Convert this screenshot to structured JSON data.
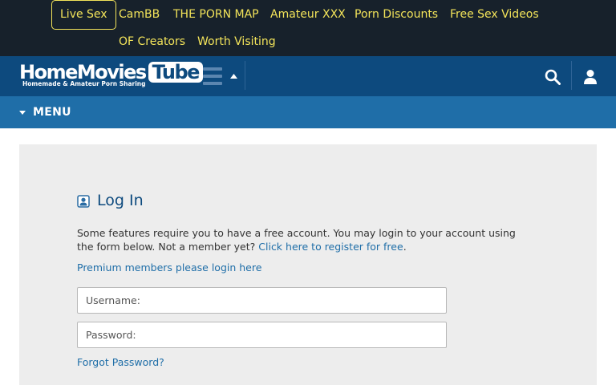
{
  "top_links": [
    "Live Sex",
    "CamBB",
    "THE PORN MAP",
    "Amateur XXX",
    "Porn Discounts",
    "Free Sex Videos",
    "OF Creators",
    "Worth Visiting"
  ],
  "logo": {
    "main": "HomeMovies",
    "tube": "Tube",
    "tagline": "Homemade & Amateur Porn Sharing"
  },
  "icons": {
    "menu": "hamburger-icon",
    "expand": "caret-up-icon",
    "search": "search-icon",
    "user": "user-icon"
  },
  "menu": {
    "label": "MENU"
  },
  "login": {
    "title": "Log In",
    "desc_text": "Some features require you to have a free account. You may login to your account using the form below. Not a member yet? ",
    "register_link": "Click here to register for free",
    "premium_link": "Premium members please login here",
    "username_placeholder": "Username:",
    "password_placeholder": "Password:",
    "forgot_link": "Forgot Password?"
  },
  "colors": {
    "topbar": "#17212b",
    "link_yellow": "#f3e45a",
    "header": "#0d4a7e",
    "menubar": "#1f6ea8",
    "panel": "#ededed"
  }
}
